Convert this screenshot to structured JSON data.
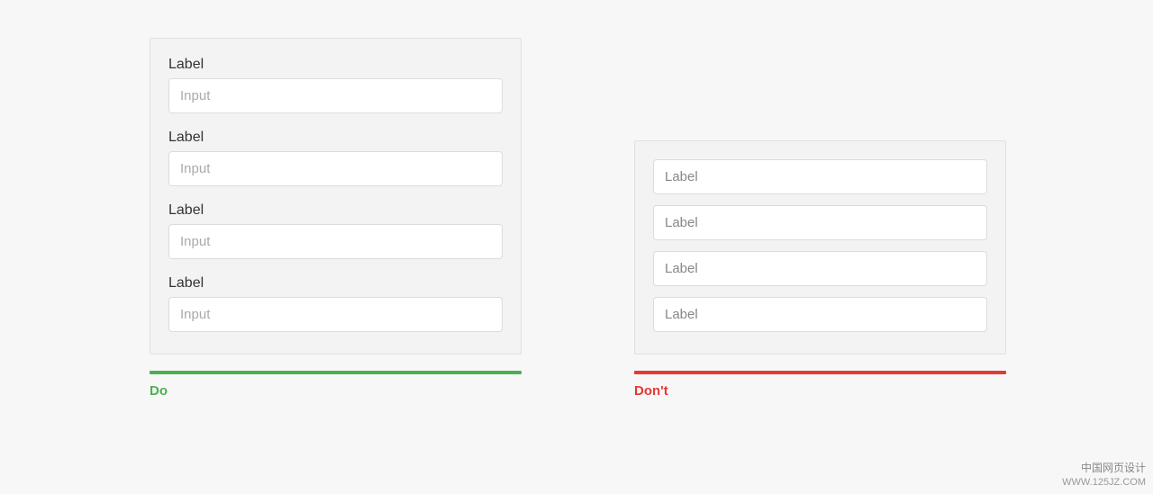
{
  "do_example": {
    "caption": "Do",
    "fields": [
      {
        "label": "Label",
        "placeholder": "Input"
      },
      {
        "label": "Label",
        "placeholder": "Input"
      },
      {
        "label": "Label",
        "placeholder": "Input"
      },
      {
        "label": "Label",
        "placeholder": "Input"
      }
    ]
  },
  "dont_example": {
    "caption": "Don't",
    "fields": [
      {
        "placeholder": "Label"
      },
      {
        "placeholder": "Label"
      },
      {
        "placeholder": "Label"
      },
      {
        "placeholder": "Label"
      }
    ]
  },
  "watermark": {
    "line1": "中国网页设计",
    "line2": "WWW.125JZ.COM"
  },
  "colors": {
    "do": "#4caf50",
    "dont": "#e53935"
  }
}
